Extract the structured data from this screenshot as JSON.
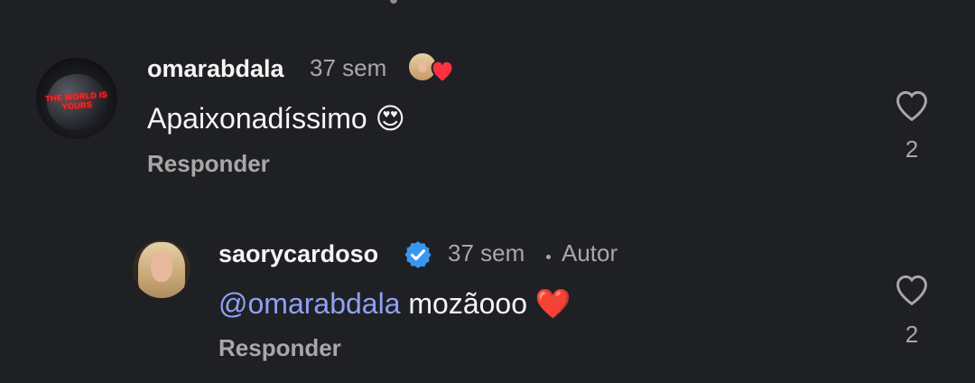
{
  "comments": [
    {
      "username": "omarabdala",
      "time": "37 sem",
      "avatar_text": "THE WORLD IS YOURS",
      "text": "Apaixonadíssimo",
      "emoji": "😍",
      "reply_label": "Responder",
      "like_count": "2",
      "author_liked": true
    },
    {
      "username": "saorycardoso",
      "verified": true,
      "time": "37 sem",
      "author_label": "Autor",
      "mention": "@omarabdala",
      "text": "mozãooo",
      "emoji": "❤️",
      "reply_label": "Responder",
      "like_count": "2"
    }
  ],
  "colors": {
    "background": "#1f2023",
    "mention": "#8ea0f7",
    "muted": "#a8a8a8",
    "verified": "#3897f0",
    "heart": "#ff3040"
  }
}
